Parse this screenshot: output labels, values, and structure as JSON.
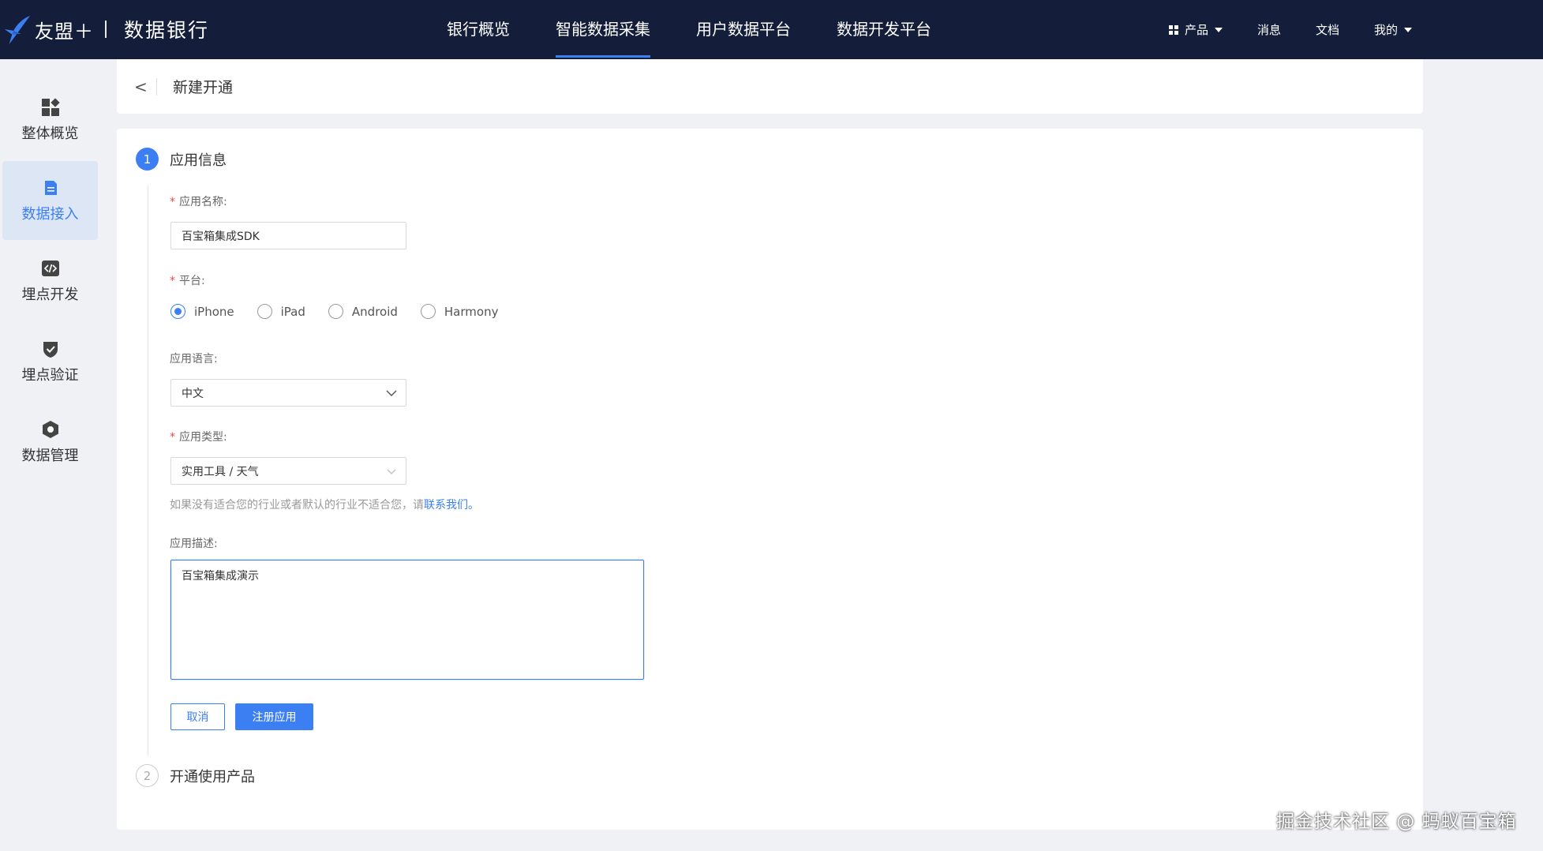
{
  "topbar": {
    "brand": "友盟＋",
    "product": "数据银行",
    "nav": [
      {
        "label": "银行概览"
      },
      {
        "label": "智能数据采集"
      },
      {
        "label": "用户数据平台"
      },
      {
        "label": "数据开发平台"
      }
    ],
    "right_menu": {
      "products": "产品",
      "messages": "消息",
      "docs": "文档",
      "mine": "我的"
    }
  },
  "sidebar": {
    "items": [
      {
        "label": "整体概览",
        "icon": "dashboard-icon"
      },
      {
        "label": "数据接入",
        "icon": "document-icon"
      },
      {
        "label": "埋点开发",
        "icon": "code-icon"
      },
      {
        "label": "埋点验证",
        "icon": "shield-check-icon"
      },
      {
        "label": "数据管理",
        "icon": "hexagon-icon"
      }
    ]
  },
  "header": {
    "back": "<",
    "title": "新建开通"
  },
  "form": {
    "step1": {
      "number": "1",
      "label": "应用信息"
    },
    "app_name": {
      "label": "应用名称:",
      "value": "百宝箱集成SDK"
    },
    "platform": {
      "label": "平台:",
      "options": [
        "iPhone",
        "iPad",
        "Android",
        "Harmony"
      ],
      "selected": "iPhone"
    },
    "language": {
      "label": "应用语言:",
      "value": "中文"
    },
    "app_type": {
      "label": "应用类型:",
      "value": "实用工具 / 天气"
    },
    "hint": {
      "text": "如果没有适合您的行业或者默认的行业不适合您，请",
      "link": "联系我们。"
    },
    "description": {
      "label": "应用描述:",
      "value": "百宝箱集成演示"
    },
    "cancel": "取消",
    "submit": "注册应用",
    "step2": {
      "number": "2",
      "label": "开通使用产品"
    }
  },
  "watermark": "掘金技术社区 @ 蚂蚁百宝箱",
  "colors": {
    "accent": "#3b7ff2",
    "topbar": "#141e3a",
    "required": "#f04a4a"
  }
}
